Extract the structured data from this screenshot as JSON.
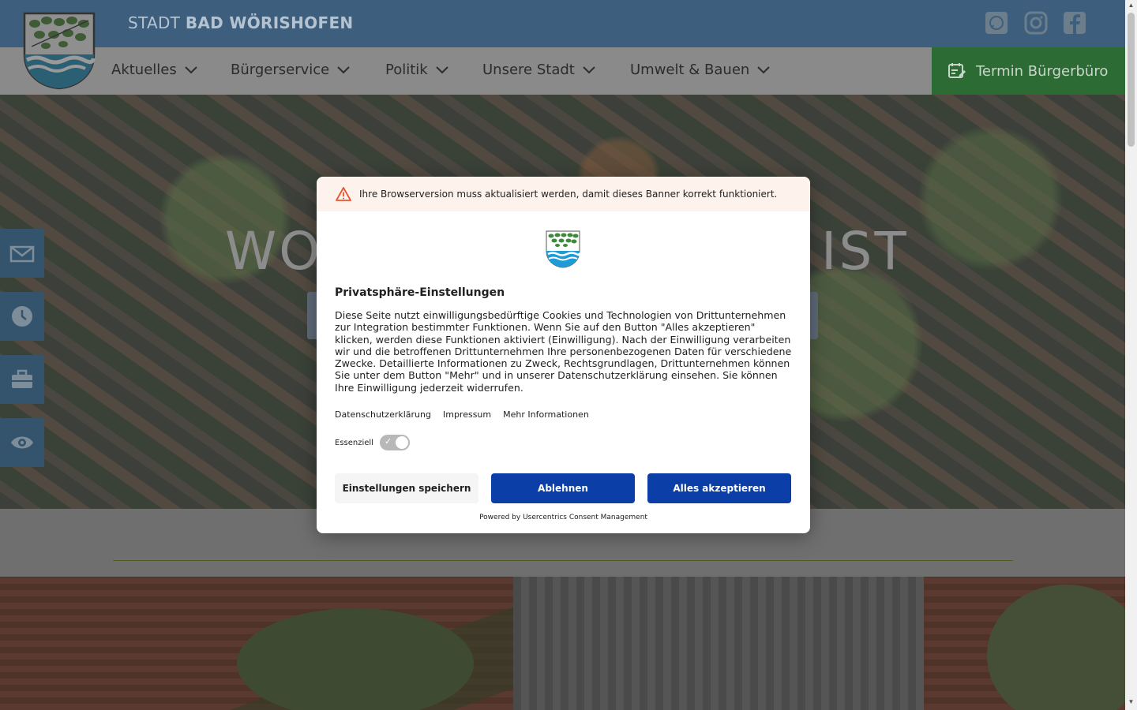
{
  "header": {
    "brand_prefix": "STADT",
    "brand_name": "BAD WÖRISHOFEN",
    "social": [
      "whatsapp-icon",
      "instagram-icon",
      "facebook-icon"
    ]
  },
  "nav": {
    "items": [
      {
        "label": "Aktuelles"
      },
      {
        "label": "Bürgerservice"
      },
      {
        "label": "Politik"
      },
      {
        "label": "Unsere Stadt"
      },
      {
        "label": "Umwelt & Bauen"
      }
    ],
    "termin_label": "Termin Bürgerbüro"
  },
  "hero": {
    "title_left": "WO",
    "title_right": "IST"
  },
  "side_buttons": [
    "mail-icon",
    "clock-icon",
    "briefcase-icon",
    "eye-icon"
  ],
  "consent": {
    "warning": "Ihre Browserversion muss aktualisiert werden, damit dieses Banner korrekt funktioniert.",
    "title": "Privatsphäre-Einstellungen",
    "body": "Diese Seite nutzt einwilligungsbedürftige Cookies und Technologien von Drittunternehmen zur Integration bestimmter Funktionen. Wenn Sie auf den Button \"Alles akzeptieren\" klicken, werden diese Funktionen aktiviert (Einwilligung). Nach der Einwilligung verarbeiten wir und die betroffenen Drittunternehmen Ihre personenbezogenen Daten für verschiedene Zwecke. Detaillierte Informationen zu Zweck, Rechtsgrundlagen, Drittunternehmen können Sie unter dem Button \"Mehr\" und in unserer Datenschutzerklärung einsehen. Sie können Ihre Einwilligung jederzeit widerrufen.",
    "links": {
      "privacy": "Datenschutzerklärung",
      "imprint": "Impressum",
      "more": "Mehr Informationen"
    },
    "essential_label": "Essenziell",
    "essential_enabled": true,
    "buttons": {
      "save": "Einstellungen speichern",
      "deny": "Ablehnen",
      "accept": "Alles akzeptieren"
    },
    "powered_by": "Powered by Usercentrics Consent Management",
    "colors": {
      "primary": "#0b3fa7",
      "warning_bg": "#fdf2ec",
      "warning_icon": "#e8542f"
    }
  },
  "colors": {
    "topbar": "#3d5f7d",
    "termin": "#2d6b35"
  }
}
